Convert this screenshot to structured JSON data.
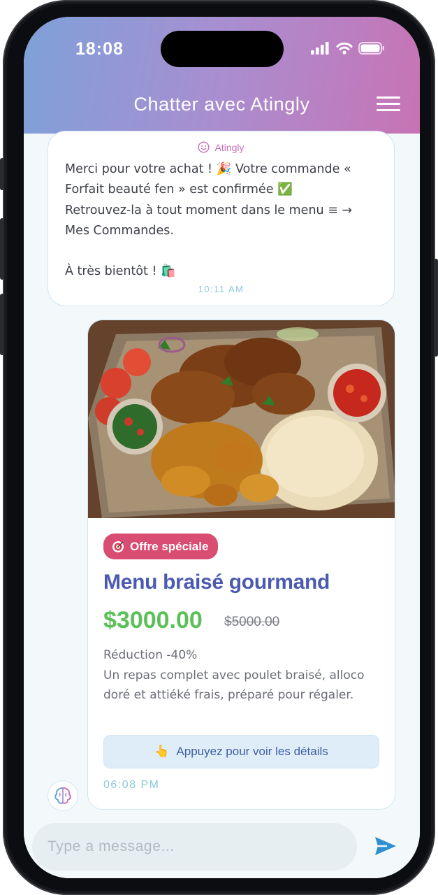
{
  "status_bar": {
    "time": "18:08"
  },
  "header": {
    "title": "Chatter avec Atingly"
  },
  "bot_message": {
    "sender": "Atingly",
    "text": "Merci pour votre achat ! 🎉 Votre commande « Forfait beauté fen » est confirmée ✅\nRetrouvez-la à tout moment dans le menu ≡ →\nMes Commandes.\n\nÀ très bientôt ! 🛍️",
    "time": "10:11 AM"
  },
  "offer_card": {
    "badge": "Offre spéciale",
    "title": "Menu braisé gourmand",
    "price": "$3000.00",
    "old_price": "$5000.00",
    "description": "Réduction -40%\nUn repas complet avec poulet braisé, alloco doré et attiéké frais, préparé pour régaler.",
    "details_button": "Appuyez pour voir les détails",
    "time": "06:08 PM"
  },
  "composer": {
    "placeholder": "Type a message..."
  },
  "colors": {
    "header_gradient": [
      "#7ea1d9",
      "#a98ed0",
      "#c873b4"
    ],
    "title": "#4b5ab0",
    "price": "#5cc05a",
    "badge": "#d94d72",
    "send": "#2f8fd0"
  },
  "icons": [
    "signal-icon",
    "wifi-icon",
    "battery-icon",
    "menu-icon",
    "smiley-icon",
    "target-icon",
    "pointing-hand-icon",
    "brain-avatar-icon",
    "send-icon"
  ]
}
